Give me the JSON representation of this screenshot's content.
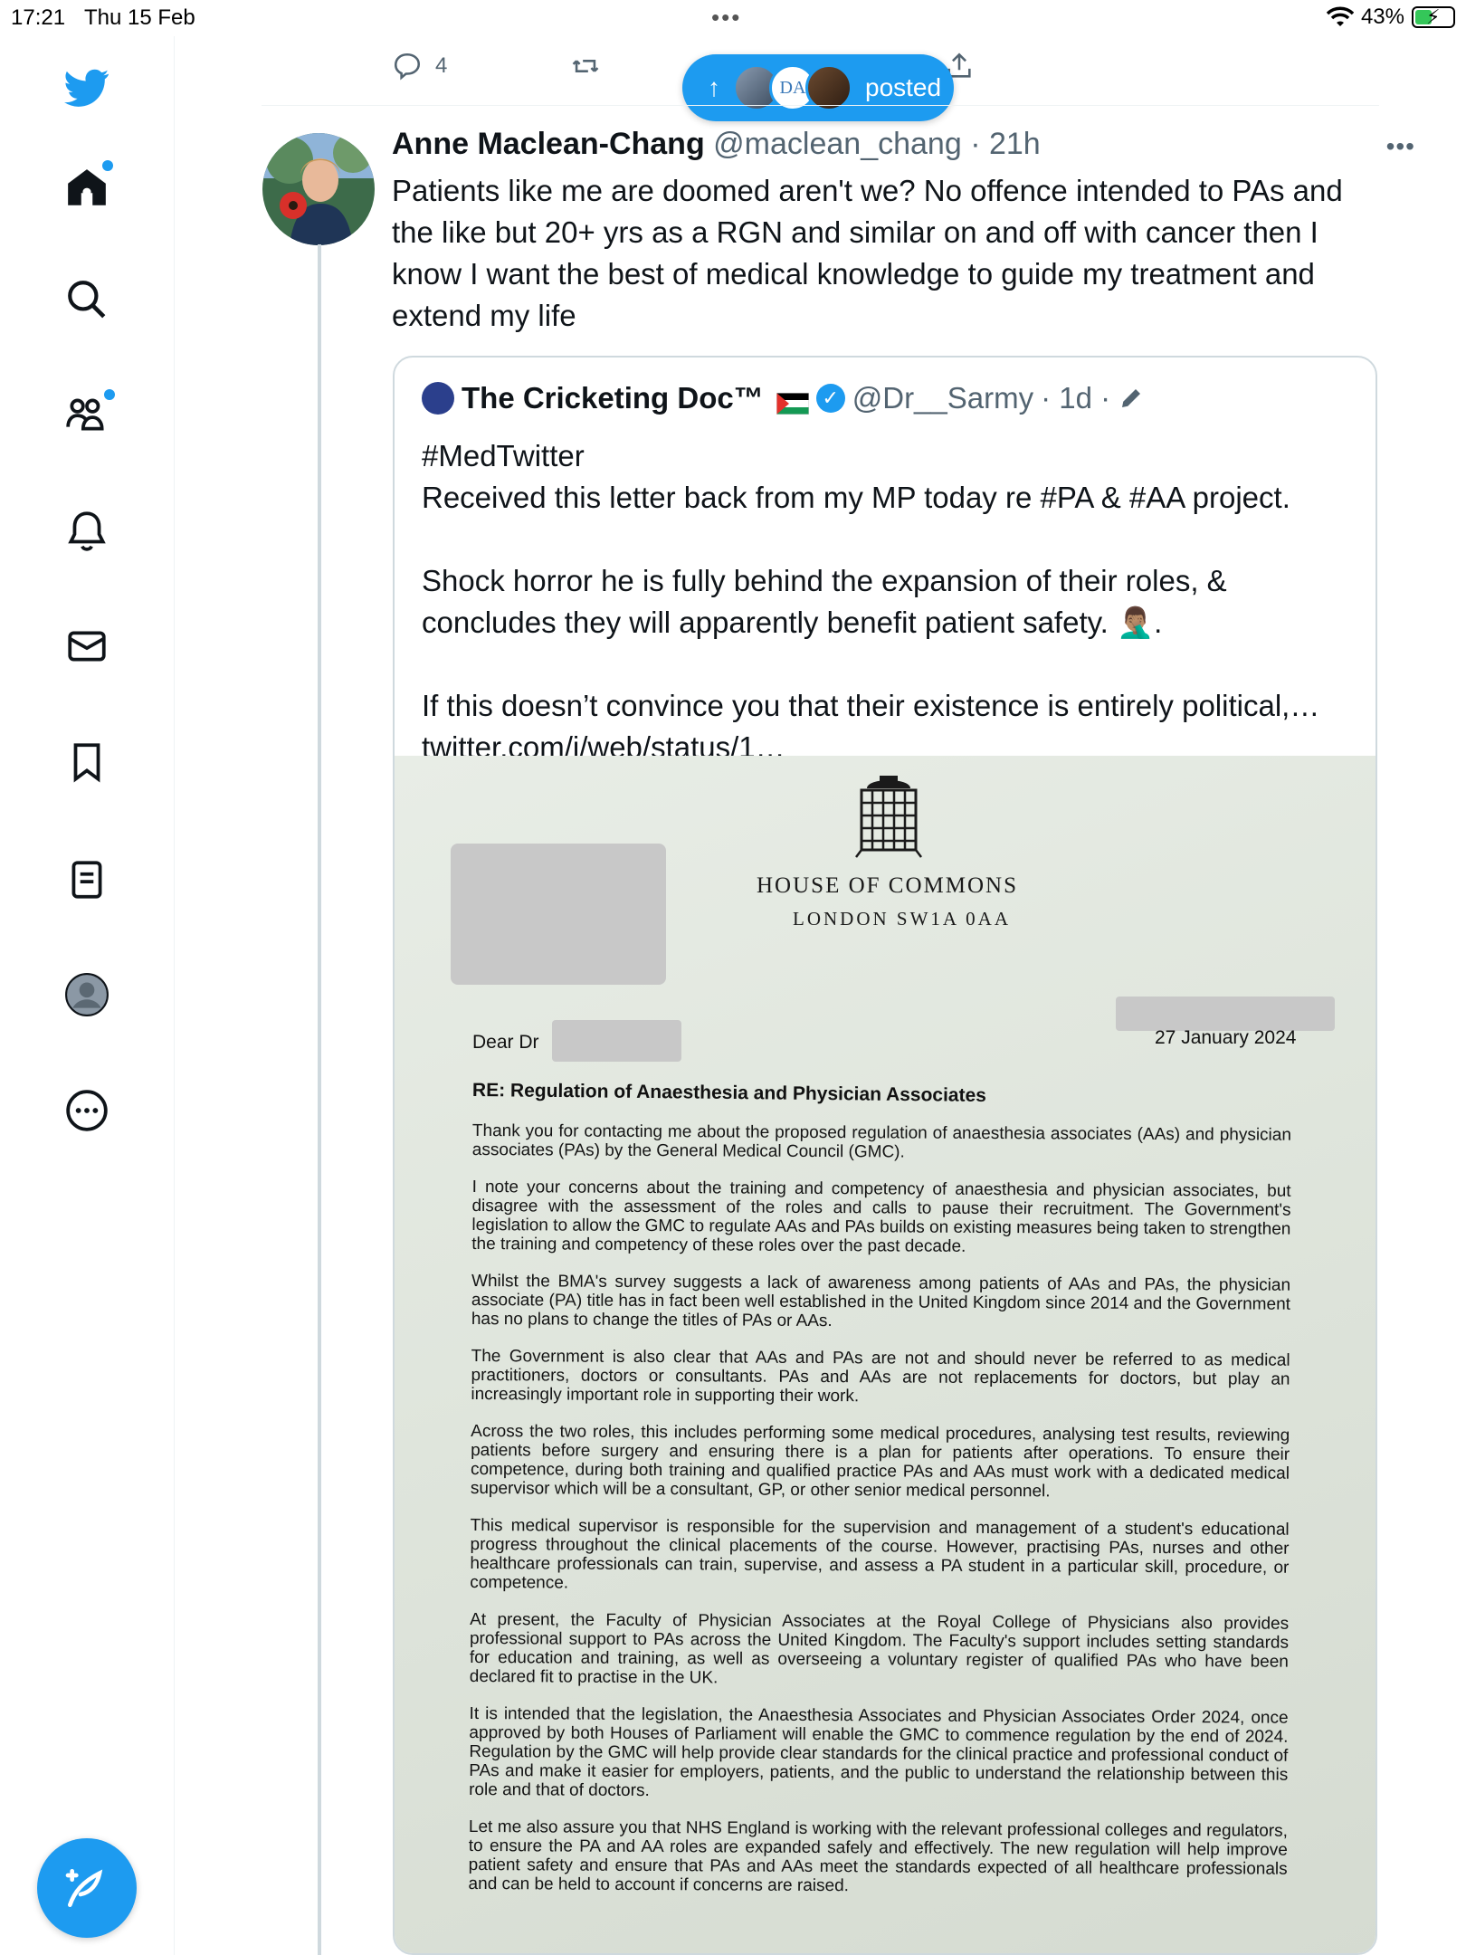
{
  "status_bar": {
    "time": "17:21",
    "date": "Thu 15 Feb",
    "battery": "43%"
  },
  "sidebar": {
    "items": [
      {
        "icon": "twitter-bird-icon"
      },
      {
        "icon": "home-icon"
      },
      {
        "icon": "search-icon"
      },
      {
        "icon": "communities-icon"
      },
      {
        "icon": "bell-icon"
      },
      {
        "icon": "mail-icon"
      },
      {
        "icon": "bookmark-icon"
      },
      {
        "icon": "lists-icon"
      },
      {
        "icon": "profile-icon"
      },
      {
        "icon": "more-icon"
      }
    ],
    "compose_icon": "compose-icon"
  },
  "prev_actions": {
    "reply_count": "4"
  },
  "posted_pill": {
    "label": "posted",
    "avatar_text": "DA"
  },
  "tweet": {
    "name": "Anne Maclean-Chang",
    "handle": "@maclean_chang",
    "time": "· 21h",
    "text": "Patients like me are doomed aren't we? No offence intended to PAs and the like but 20+ yrs as a RGN and similar on and off with cancer then I know I want the best of medical knowledge to guide my treatment and extend my life"
  },
  "quote": {
    "name": "The Cricketing Doc™",
    "handle": "@Dr__Sarmy",
    "time": "· 1d ·",
    "text": "#MedTwitter\nReceived this letter back from my MP today re #PA & #AA project.\n\nShock horror he is fully behind the expansion of their roles, & concludes they will apparently benefit patient safety. 🤦🏽‍♂️.\n\nIf this doesn’t convince you that their existence is entirely political,… twitter.com/i/web/status/1…"
  },
  "letter": {
    "house": "HOUSE OF COMMONS",
    "address": "LONDON SW1A 0AA",
    "salutation": "Dear Dr",
    "date": "27 January 2024",
    "subject": "RE: Regulation of Anaesthesia and Physician Associates",
    "paragraphs": [
      "Thank you for contacting me about the proposed regulation of anaesthesia associates (AAs) and physician associates (PAs) by the General Medical Council (GMC).",
      "I note your concerns about the training and competency of anaesthesia and physician associates, but disagree with the assessment of the roles and calls to pause their recruitment. The Government's legislation to allow the GMC to regulate AAs and PAs builds on existing measures being taken to strengthen the training and competency of these roles over the past decade.",
      "Whilst the BMA's survey suggests a lack of awareness among patients of AAs and PAs, the physician associate (PA) title has in fact been well established in the United Kingdom since 2014 and the Government has no plans to change the titles of PAs or AAs.",
      "The Government is also clear that AAs and PAs are not and should never be referred to as medical practitioners, doctors or consultants. PAs and AAs are not replacements for doctors, but play an increasingly important role in supporting their work.",
      "Across the two roles, this includes performing some medical procedures, analysing test results, reviewing patients before surgery and ensuring there is a plan for patients after operations. To ensure their competence, during both training and qualified practice PAs and AAs must work with a dedicated medical supervisor which will be a consultant, GP, or other senior medical personnel.",
      "This medical supervisor is responsible for the supervision and management of a student's educational progress throughout the clinical placements of the course. However, practising PAs, nurses and other healthcare professionals can train, supervise, and assess a PA student in a particular skill, procedure, or competence.",
      "At present, the Faculty of Physician Associates at the Royal College of Physicians also provides professional support to PAs across the United Kingdom. The Faculty's support includes setting standards for education and training, as well as overseeing a voluntary register of qualified PAs who have been declared fit to practise in the UK.",
      "It is intended that the legislation, the Anaesthesia Associates and Physician Associates Order 2024, once approved by both Houses of Parliament will enable the GMC to commence regulation by the end of 2024. Regulation by the GMC will help provide clear standards for the clinical practice and professional conduct of PAs and make it easier for employers, patients, and the public to understand the relationship between this role and that of doctors.",
      "Let me also assure you that NHS England is working with the relevant professional colleges and regulators, to ensure the PA and AA roles are expanded safely and effectively. The new regulation will help improve patient safety and ensure that PAs and AAs meet the standards expected of all healthcare professionals and can be held to account if concerns are raised."
    ]
  },
  "colors": {
    "accent": "#1d9bf0",
    "text": "#0f1419",
    "muted": "#536471",
    "border": "#cfd9de"
  }
}
